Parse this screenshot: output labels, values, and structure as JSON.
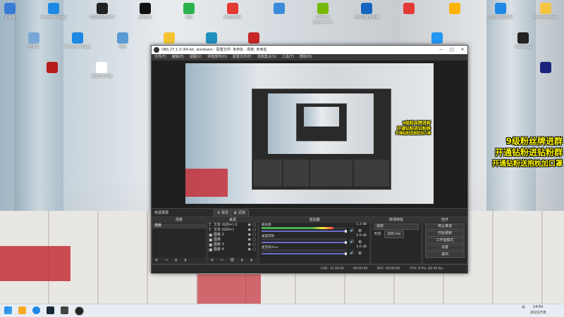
{
  "desktop": {
    "icons": [
      {
        "label": "此电脑",
        "color": "#3a7bd5"
      },
      {
        "label": "Microsoft Edge",
        "color": "#1e88e5"
      },
      {
        "label": "中国体育直播TV",
        "color": "#222222"
      },
      {
        "label": "腾讯QQ",
        "color": "#111111"
      },
      {
        "label": "微信",
        "color": "#2bb24c"
      },
      {
        "label": "网易云音乐",
        "color": "#e53935"
      },
      {
        "label": "",
        "color": "#3b8ad9"
      },
      {
        "label": "GeForce Experience",
        "color": "#76b900"
      },
      {
        "label": "搜狗高速浏览器",
        "color": "#1565c0"
      },
      {
        "label": "",
        "color": "#e53935"
      },
      {
        "label": "",
        "color": "#ffb300"
      },
      {
        "label": "向日葵远程控制",
        "color": "#1e88e5"
      },
      {
        "label": "Administrator",
        "color": "#f5c542"
      },
      {
        "label": "回收站",
        "color": "#7aa7d6"
      },
      {
        "label": "Microsoft Edge",
        "color": "#1e88e5"
      },
      {
        "label": "网络",
        "color": "#5b9bd5"
      },
      {
        "label": "",
        "color": "#f4c430"
      },
      {
        "label": "",
        "color": "#1f8fbf"
      },
      {
        "label": "",
        "color": "#c62828"
      },
      {
        "label": "",
        "color": "#2196f3"
      },
      {
        "label": "WeGame",
        "color": "#222222"
      },
      {
        "label": "",
        "color": "#b71c1c"
      },
      {
        "label": "新建文本文档",
        "color": "#ffffff"
      },
      {
        "label": "",
        "color": "#1a237e"
      }
    ],
    "promo_lines": [
      "9级粉丝牌进群",
      "开通钻粉进钻粉群",
      "开通钻粉送抱枕加口罩"
    ]
  },
  "obs": {
    "title": "OBS 27.1.3 (64-bit, windows) - 配置文件: 未命名 - 场景: 未命名",
    "window_controls": [
      "—",
      "□",
      "✕"
    ],
    "menu": [
      "文件(F)",
      "编辑(E)",
      "视图(V)",
      "停靠部件(D)",
      "配置文件(P)",
      "场景集合(S)",
      "工具(T)",
      "帮助(H)"
    ],
    "no_source": "未选择源",
    "preview_buttons": [
      "⚙ 属性",
      "◐ 滤镜"
    ],
    "docks": {
      "scenes": {
        "title": "场景",
        "items": [
          "场景"
        ],
        "footer": "+ − ∧ ∨"
      },
      "sources": {
        "title": "来源",
        "items": [
          "文本 (GDI+) 2",
          "文本 (GDI+)",
          "图像 2",
          "图像",
          "图像 3",
          "图像 4"
        ],
        "footer": "+ − ⚙ ∧ ∨"
      },
      "mixer": {
        "title": "混音器",
        "channels": [
          {
            "name": "媒体源",
            "db": "-1.3 dB",
            "level": 0.85
          },
          {
            "name": "桌面音频",
            "db": "0.0 dB",
            "level": 0.0
          },
          {
            "name": "麦克风/Aux",
            "db": "0.0 dB",
            "level": 0.0
          }
        ]
      },
      "transitions": {
        "title": "转场特效",
        "type": "渐变",
        "duration_label": "时长",
        "duration": "300 ms"
      },
      "controls": {
        "title": "控件",
        "buttons": [
          "停止推流",
          "开始录制",
          "工作室模式",
          "设置",
          "退出"
        ]
      }
    },
    "status": {
      "live": "LIVE: 12:16:00",
      "rec": "REC: 00:00:00",
      "cpu": "CPU: 0.0%, 60.00 fps",
      "dropped": "00:00:00"
    }
  },
  "taskbar": {
    "time": "14:50",
    "date": "2022/7/8",
    "tray_text": "中"
  }
}
